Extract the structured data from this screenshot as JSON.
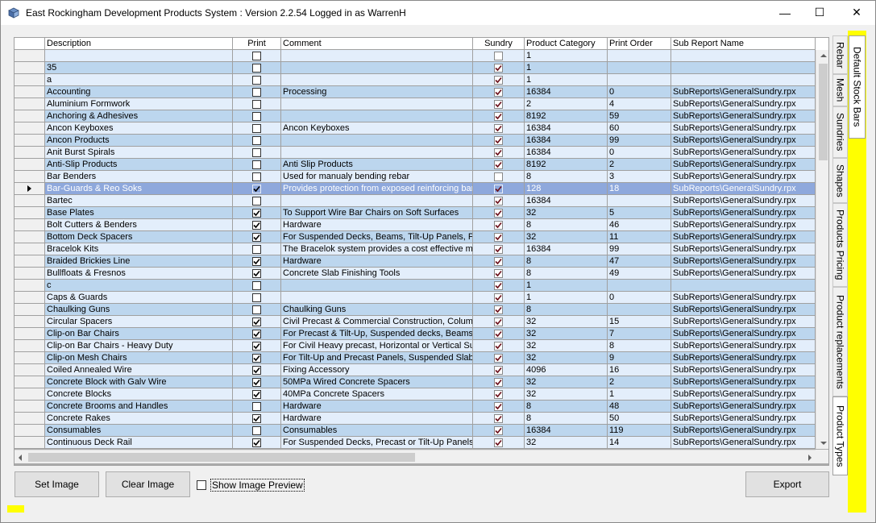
{
  "window": {
    "title": "East Rockingham Development Products System : Version 2.2.54 Logged in as WarrenH",
    "minimize": "—",
    "maximize": "☐",
    "close": "✕"
  },
  "grid": {
    "columns": [
      "Description",
      "Print",
      "Comment",
      "Sundry",
      "Product Category",
      "Print Order",
      "Sub Report Name"
    ],
    "rows": [
      {
        "desc": "",
        "print": false,
        "comment": "",
        "sundry": false,
        "cat": "1",
        "order": "",
        "report": "",
        "dim": false
      },
      {
        "desc": "35",
        "print": false,
        "comment": "",
        "sundry": true,
        "cat": "1",
        "order": "",
        "report": "",
        "dim": true
      },
      {
        "desc": "a",
        "print": false,
        "comment": "",
        "sundry": true,
        "cat": "1",
        "order": "",
        "report": "",
        "dim": false
      },
      {
        "desc": "Accounting",
        "print": false,
        "comment": "Processing",
        "sundry": true,
        "cat": "16384",
        "order": "0",
        "report": "SubReports\\GeneralSundry.rpx",
        "dim": true
      },
      {
        "desc": "Aluminium Formwork",
        "print": false,
        "comment": "",
        "sundry": true,
        "cat": "2",
        "order": "4",
        "report": "SubReports\\GeneralSundry.rpx",
        "dim": false
      },
      {
        "desc": "Anchoring & Adhesives",
        "print": false,
        "comment": "",
        "sundry": true,
        "cat": "8192",
        "order": "59",
        "report": "SubReports\\GeneralSundry.rpx",
        "dim": true
      },
      {
        "desc": "Ancon Keyboxes",
        "print": false,
        "comment": "Ancon Keyboxes",
        "sundry": true,
        "cat": "16384",
        "order": "60",
        "report": "SubReports\\GeneralSundry.rpx",
        "dim": false
      },
      {
        "desc": "Ancon Products",
        "print": false,
        "comment": "",
        "sundry": true,
        "cat": "16384",
        "order": "99",
        "report": "SubReports\\GeneralSundry.rpx",
        "dim": true
      },
      {
        "desc": "Anit Burst Spirals",
        "print": false,
        "comment": "",
        "sundry": true,
        "cat": "16384",
        "order": "0",
        "report": "SubReports\\GeneralSundry.rpx",
        "dim": false
      },
      {
        "desc": "Anti-Slip Products",
        "print": false,
        "comment": "Anti Slip Products",
        "sundry": true,
        "cat": "8192",
        "order": "2",
        "report": "SubReports\\GeneralSundry.rpx",
        "dim": true
      },
      {
        "desc": "Bar Benders",
        "print": false,
        "comment": "Used for manualy bending rebar",
        "sundry": false,
        "cat": "8",
        "order": "3",
        "report": "SubReports\\GeneralSundry.rpx",
        "dim": false
      },
      {
        "desc": "Bar-Guards & Reo Soks",
        "print": true,
        "comment": "Provides protection from exposed reinforcing bar",
        "sundry": true,
        "cat": "128",
        "order": "18",
        "report": "SubReports\\GeneralSundry.rpx",
        "dim": false,
        "selected": true
      },
      {
        "desc": "Bartec",
        "print": false,
        "comment": "",
        "sundry": true,
        "cat": "16384",
        "order": "",
        "report": "SubReports\\GeneralSundry.rpx",
        "dim": false
      },
      {
        "desc": "Base Plates",
        "print": true,
        "comment": "To Support Wire Bar Chairs on Soft Surfaces",
        "sundry": true,
        "cat": "32",
        "order": "5",
        "report": "SubReports\\GeneralSundry.rpx",
        "dim": true
      },
      {
        "desc": "Bolt Cutters & Benders",
        "print": true,
        "comment": "Hardware",
        "sundry": true,
        "cat": "8",
        "order": "46",
        "report": "SubReports\\GeneralSundry.rpx",
        "dim": false
      },
      {
        "desc": "Bottom Deck Spacers",
        "print": true,
        "comment": "For Suspended Decks, Beams, Tilt-Up Panels, Pr",
        "sundry": true,
        "cat": "32",
        "order": "11",
        "report": "SubReports\\GeneralSundry.rpx",
        "dim": true
      },
      {
        "desc": "Bracelok Kits",
        "print": false,
        "comment": "The Bracelok system provides a cost effective me",
        "sundry": true,
        "cat": "16384",
        "order": "99",
        "report": "SubReports\\GeneralSundry.rpx",
        "dim": false
      },
      {
        "desc": "Braided Brickies Line",
        "print": true,
        "comment": "Hardware",
        "sundry": true,
        "cat": "8",
        "order": "47",
        "report": "SubReports\\GeneralSundry.rpx",
        "dim": true
      },
      {
        "desc": "Bullfloats & Fresnos",
        "print": true,
        "comment": "Concrete Slab Finishing Tools",
        "sundry": true,
        "cat": "8",
        "order": "49",
        "report": "SubReports\\GeneralSundry.rpx",
        "dim": false
      },
      {
        "desc": "c",
        "print": false,
        "comment": "",
        "sundry": true,
        "cat": "1",
        "order": "",
        "report": "",
        "dim": true
      },
      {
        "desc": "Caps & Guards",
        "print": false,
        "comment": "",
        "sundry": true,
        "cat": "1",
        "order": "0",
        "report": "SubReports\\GeneralSundry.rpx",
        "dim": false
      },
      {
        "desc": "Chaulking Guns",
        "print": false,
        "comment": "Chaulking Guns",
        "sundry": true,
        "cat": "8",
        "order": "",
        "report": "SubReports\\GeneralSundry.rpx",
        "dim": true
      },
      {
        "desc": "Circular Spacers",
        "print": true,
        "comment": "Civil Precast & Commercial Construction, Columns",
        "sundry": true,
        "cat": "32",
        "order": "15",
        "report": "SubReports\\GeneralSundry.rpx",
        "dim": false
      },
      {
        "desc": "Clip-on Bar Chairs",
        "print": true,
        "comment": "For Precast & Tilt-Up, Suspended decks, Beams,",
        "sundry": true,
        "cat": "32",
        "order": "7",
        "report": "SubReports\\GeneralSundry.rpx",
        "dim": true
      },
      {
        "desc": "Clip-on Bar Chairs - Heavy Duty",
        "print": true,
        "comment": "For Civil Heavy precast, Horizontal or Vertical Sus",
        "sundry": true,
        "cat": "32",
        "order": "8",
        "report": "SubReports\\GeneralSundry.rpx",
        "dim": false
      },
      {
        "desc": "Clip-on Mesh Chairs",
        "print": true,
        "comment": "For Tilt-Up and Precast Panels, Suspended Slabs",
        "sundry": true,
        "cat": "32",
        "order": "9",
        "report": "SubReports\\GeneralSundry.rpx",
        "dim": true
      },
      {
        "desc": "Coiled Annealed Wire",
        "print": true,
        "comment": "Fixing Accessory",
        "sundry": true,
        "cat": "4096",
        "order": "16",
        "report": "SubReports\\GeneralSundry.rpx",
        "dim": false
      },
      {
        "desc": "Concrete Block with Galv Wire",
        "print": true,
        "comment": "50MPa Wired Concrete Spacers",
        "sundry": true,
        "cat": "32",
        "order": "2",
        "report": "SubReports\\GeneralSundry.rpx",
        "dim": true
      },
      {
        "desc": "Concrete Blocks",
        "print": true,
        "comment": "40MPa Concrete Spacers",
        "sundry": true,
        "cat": "32",
        "order": "1",
        "report": "SubReports\\GeneralSundry.rpx",
        "dim": false
      },
      {
        "desc": "Concrete Brooms and Handles",
        "print": false,
        "comment": "Hardware",
        "sundry": true,
        "cat": "8",
        "order": "48",
        "report": "SubReports\\GeneralSundry.rpx",
        "dim": true
      },
      {
        "desc": "Concrete Rakes",
        "print": true,
        "comment": "Hardware",
        "sundry": true,
        "cat": "8",
        "order": "50",
        "report": "SubReports\\GeneralSundry.rpx",
        "dim": false
      },
      {
        "desc": "Consumables",
        "print": false,
        "comment": "Consumables",
        "sundry": true,
        "cat": "16384",
        "order": "119",
        "report": "SubReports\\GeneralSundry.rpx",
        "dim": true
      },
      {
        "desc": "Continuous Deck Rail",
        "print": true,
        "comment": "For Suspended Decks, Precast or Tilt-Up Panels,",
        "sundry": true,
        "cat": "32",
        "order": "14",
        "report": "SubReports\\GeneralSundry.rpx",
        "dim": false
      }
    ]
  },
  "buttons": {
    "set_image": "Set Image",
    "clear_image": "Clear Image",
    "show_preview": "Show Image Preview",
    "export": "Export"
  },
  "tabs": {
    "inner": [
      "Rebar",
      "Mesh",
      "Sundries",
      "Shapes",
      "Products Pricing",
      "Product replacements",
      "Product Types"
    ],
    "outer": [
      "Default Stock Bars"
    ]
  },
  "colors": {
    "row_light": "#e3eefb",
    "row_dark": "#bcd6ee",
    "row_selected": "#8ea8dc",
    "accent": "#ffff00"
  }
}
